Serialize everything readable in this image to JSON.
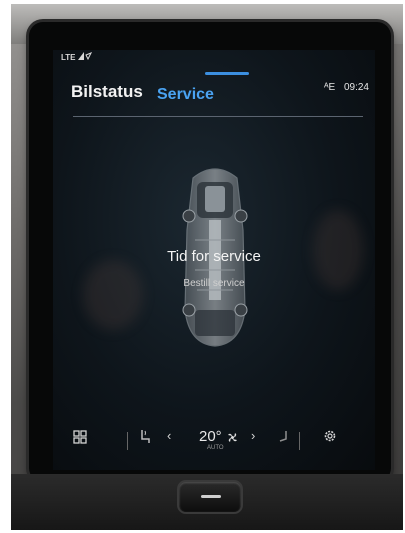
{
  "status_bar": {
    "signal_text": "LTE",
    "network_indicator": "ᴬE",
    "time": "09:24"
  },
  "header": {
    "tab_bilstatus": "Bilstatus",
    "tab_service": "Service",
    "active_tab": "Service"
  },
  "service": {
    "title": "Tid for service",
    "subtitle": "Bestill service"
  },
  "climate": {
    "temperature": "20°",
    "mode": "AUTO"
  },
  "colors": {
    "accent": "#4aa3f2",
    "screen_bg": "#0e151b"
  }
}
